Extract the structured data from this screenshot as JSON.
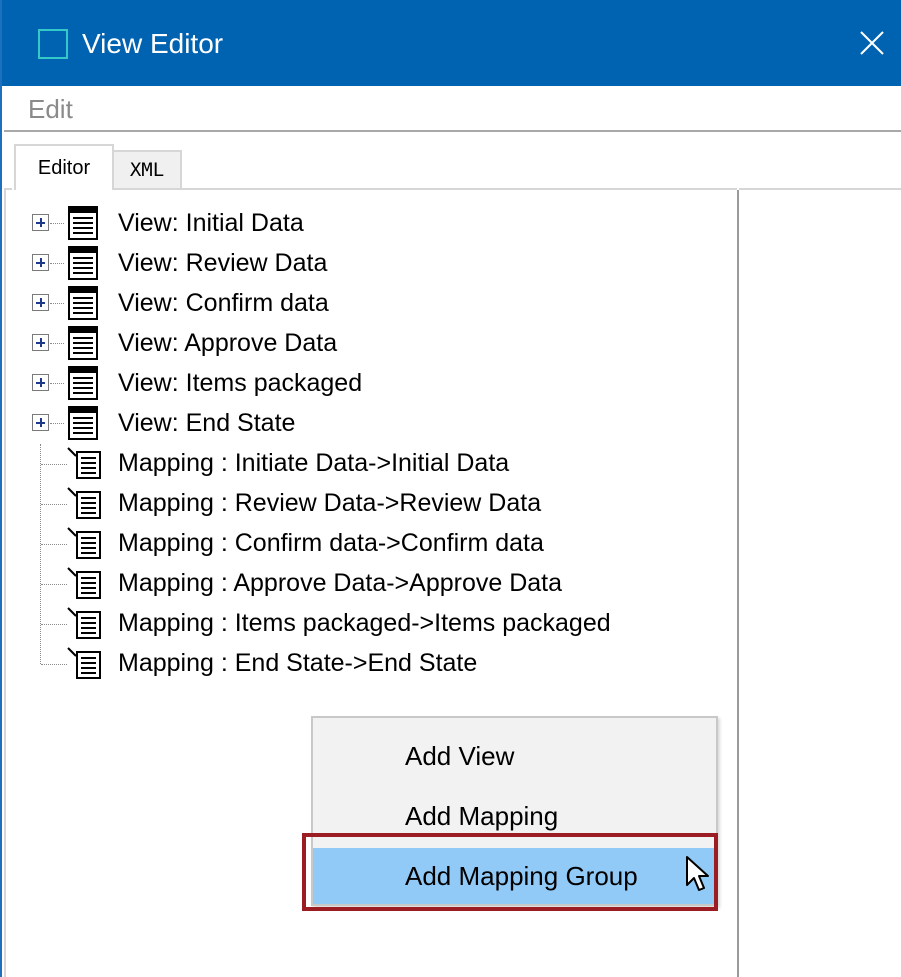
{
  "window": {
    "title": "View Editor",
    "close_icon": "close-icon",
    "accent_color": "#0063b1"
  },
  "menu": {
    "edit_label": "Edit"
  },
  "tabs": [
    {
      "label": "Editor",
      "active": true
    },
    {
      "label": "XML",
      "active": false
    }
  ],
  "tree": {
    "items": [
      {
        "label": "View: Initial Data",
        "expandable": true,
        "icon": "list-icon"
      },
      {
        "label": "View: Review Data",
        "expandable": true,
        "icon": "list-icon"
      },
      {
        "label": "View: Confirm data",
        "expandable": true,
        "icon": "list-icon"
      },
      {
        "label": "View: Approve Data",
        "expandable": true,
        "icon": "list-icon"
      },
      {
        "label": "View: Items packaged",
        "expandable": true,
        "icon": "list-icon"
      },
      {
        "label": "View: End State",
        "expandable": true,
        "icon": "list-icon"
      },
      {
        "label": "Mapping : Initiate Data->Initial Data",
        "expandable": false,
        "icon": "mapping-icon"
      },
      {
        "label": "Mapping : Review Data->Review Data",
        "expandable": false,
        "icon": "mapping-icon"
      },
      {
        "label": "Mapping : Confirm data->Confirm data",
        "expandable": false,
        "icon": "mapping-icon"
      },
      {
        "label": "Mapping : Approve Data->Approve Data",
        "expandable": false,
        "icon": "mapping-icon"
      },
      {
        "label": "Mapping : Items packaged->Items packaged",
        "expandable": false,
        "icon": "mapping-icon"
      },
      {
        "label": "Mapping : End State->End State",
        "expandable": false,
        "icon": "mapping-icon"
      }
    ]
  },
  "context_menu": {
    "items": [
      {
        "label": "Add View",
        "highlighted": false
      },
      {
        "label": "Add Mapping",
        "highlighted": false
      },
      {
        "label": "Add Mapping Group",
        "highlighted": true
      }
    ],
    "hover_color": "#91c9f7",
    "highlight_border_color": "#9b1c22"
  }
}
